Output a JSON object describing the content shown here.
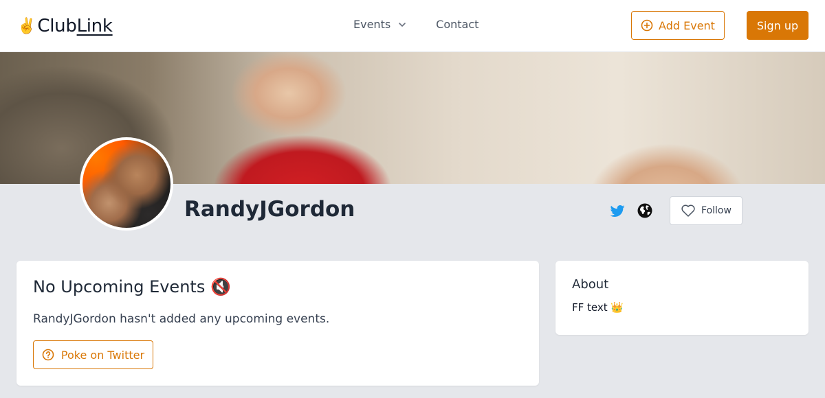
{
  "header": {
    "logo_emoji": "✌️",
    "logo_part1": "Club",
    "logo_part2": "Link",
    "nav": {
      "events_label": "Events",
      "contact_label": "Contact"
    },
    "add_event_label": "Add Event",
    "signup_label": "Sign up"
  },
  "profile": {
    "name": "RandyJGordon",
    "follow_label": "Follow"
  },
  "events_card": {
    "title": "No Upcoming Events 🔇",
    "message": "RandyJGordon hasn't added any upcoming events.",
    "poke_label": "Poke on Twitter"
  },
  "about_card": {
    "title": "About",
    "text": "FF text 👑"
  },
  "colors": {
    "accent": "#d97706",
    "twitter": "#1d9bf0",
    "page_bg": "#e5e7eb"
  },
  "icons": [
    "chevron-down-icon",
    "plus-circle-icon",
    "twitter-icon",
    "globe-icon",
    "heart-icon",
    "question-circle-icon"
  ]
}
